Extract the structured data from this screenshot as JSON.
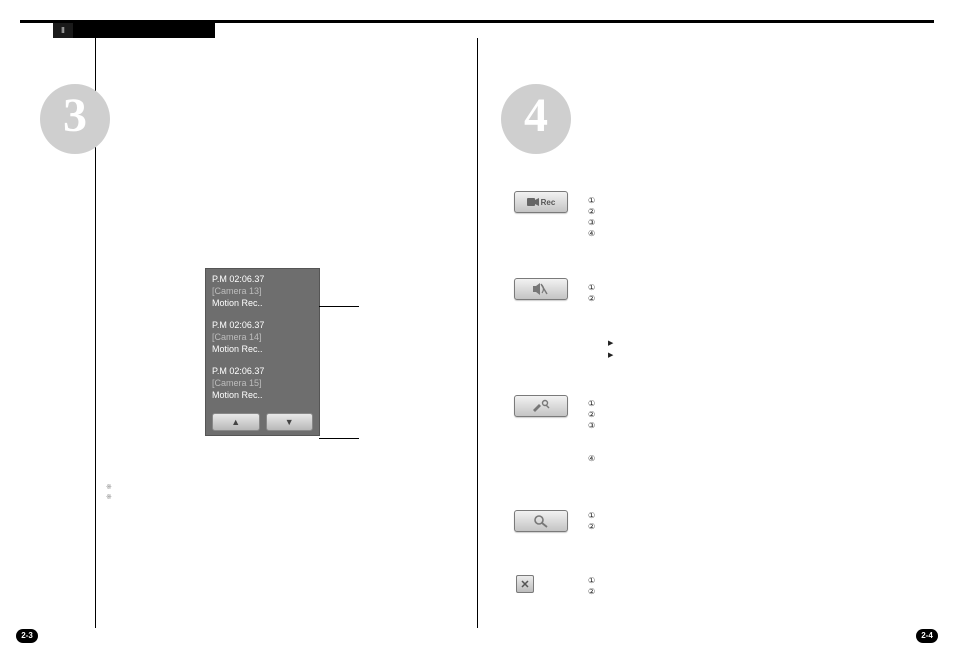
{
  "tab_marker": "Ⅱ",
  "big_numbers": {
    "left": "3",
    "right": "4"
  },
  "event_log": {
    "entries": [
      {
        "time": "P.M 02:06.37",
        "camera": "[Camera 13]",
        "message": "Motion Rec.."
      },
      {
        "time": "P.M 02:06.37",
        "camera": "[Camera 14]",
        "message": "Motion Rec.."
      },
      {
        "time": "P.M 02:06.37",
        "camera": "[Camera 15]",
        "message": "Motion Rec.."
      }
    ],
    "up": "▲",
    "down": "▼"
  },
  "buttons": {
    "rec": "Rec",
    "audio": "",
    "setup": "",
    "search": "",
    "close": "✕"
  },
  "groups": {
    "g1": {
      "n1": "①",
      "n2": "②",
      "n3": "③",
      "n4": "④"
    },
    "g2": {
      "n1": "①",
      "n2": "②"
    },
    "g3": {
      "n1": "①",
      "n2": "②",
      "n3": "③",
      "n4": "④"
    },
    "g4": {
      "n1": "①",
      "n2": "②"
    },
    "g5": {
      "n1": "①",
      "n2": "②"
    }
  },
  "page_numbers": {
    "left": "2-3",
    "right": "2-4"
  }
}
